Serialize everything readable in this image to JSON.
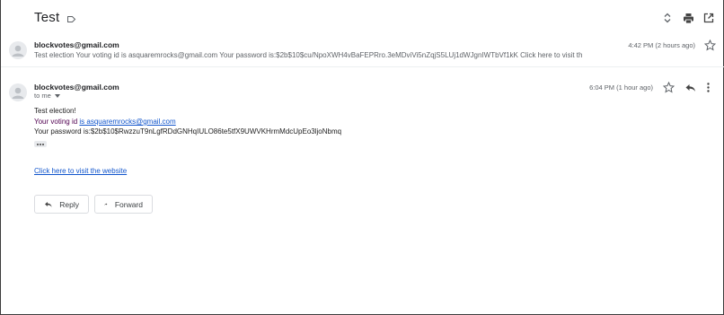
{
  "thread": {
    "subject": "Test"
  },
  "toolbar": {
    "icons": [
      "expand-collapse-icon",
      "print-icon",
      "open-in-new-window-icon"
    ]
  },
  "messages": [
    {
      "sender": "blockvotes@gmail.com",
      "snippet": "Test election Your voting id is asquaremrocks@gmail.com Your password is:$2b$10$cu/NpoXWH4vBaFEPRro.3eMDviVi5nZqjS5LUj1dWJgnIWTbVf1kK Click here to visit the we",
      "time": "4:42 PM (2 hours ago)"
    },
    {
      "sender": "blockvotes@gmail.com",
      "to": "to me",
      "time": "6:04 PM (1 hour ago)",
      "body": {
        "line1": "Test election!",
        "voting_prefix": "Your voting id ",
        "voting_email": "is asquaremrocks@gmail.com",
        "password_line": "Your password is:$2b$10$RwzzuT9nLgfRDdGNHqIULO86te5tfX9UWVKHrmMdcUpEo3ljoNbmq",
        "link_text": "Click here to visit the website"
      }
    }
  ],
  "actions": {
    "reply_label": "Reply",
    "forward_label": "Forward"
  },
  "colors": {
    "link": "#1155cc",
    "quoted": "#500050"
  }
}
